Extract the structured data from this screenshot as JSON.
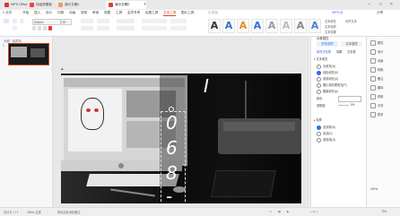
{
  "titlebar": {
    "tabs": [
      {
        "label": "WPS Office",
        "color": "#d33"
      },
      {
        "label": "找稻壳模板",
        "color": "#e44"
      },
      {
        "label": "演示文稿1",
        "color": "#e96"
      },
      {
        "label": "演示文稿2",
        "color": "#d24726"
      }
    ],
    "new_tab_label": "+"
  },
  "menubar": {
    "items": [
      "≡ 文件",
      "开始",
      "插入",
      "设计",
      "切换",
      "动画",
      "放映",
      "审阅",
      "视图",
      "工具",
      "会员专享",
      "绘图工具",
      "文本工具",
      "图片工具"
    ],
    "active": "文本工具",
    "search_placeholder": "Q 查找",
    "right_items": [
      "WPS AI",
      "分享"
    ]
  },
  "ribbon": {
    "font_name": "DejaVu",
    "font_size": "80",
    "wordart_labels": [
      "A",
      "A",
      "A",
      "A",
      "A",
      "A",
      "A",
      "A"
    ],
    "labels": [
      "文本填充",
      "文本轮廓",
      "文本效果",
      "对齐文本"
    ]
  },
  "leftpane": {
    "header_items": [
      "大纲",
      "幻灯片"
    ],
    "slide_number": "1"
  },
  "rightpane": {
    "title": "对象属性",
    "tabs": [
      "形状选项",
      "文本选项"
    ],
    "subtabs": [
      "填充与轮廓",
      "效果",
      "文本框"
    ],
    "section_fill": "▾ 文本填充",
    "fill_options": [
      "无填充(N)",
      "纯色填充(S)",
      "渐变填充(G)",
      "图片或纹理填充(P)",
      "图案填充(A)"
    ],
    "color_label": "颜色",
    "transparency_label": "透明度",
    "transparency_value": "0%",
    "section_outline": "▸ 轮廓",
    "outline_options": [
      "无线条(N)",
      "实线(S)",
      "渐变线(G)"
    ]
  },
  "farright": {
    "items": [
      "属性",
      "设计",
      "动画",
      "转换",
      "备注",
      "翻译",
      "帮助",
      "分享",
      "更多"
    ],
    "zoom_label": "100%"
  },
  "slide": {
    "vertical_chars": [
      "I",
      "0",
      "6",
      "8",
      "-"
    ]
  },
  "statusbar": {
    "slide_count": "幻灯片 1 / 1",
    "theme": "Office 主题",
    "notes_label": "单击此处添加备注",
    "zoom": "75%"
  }
}
